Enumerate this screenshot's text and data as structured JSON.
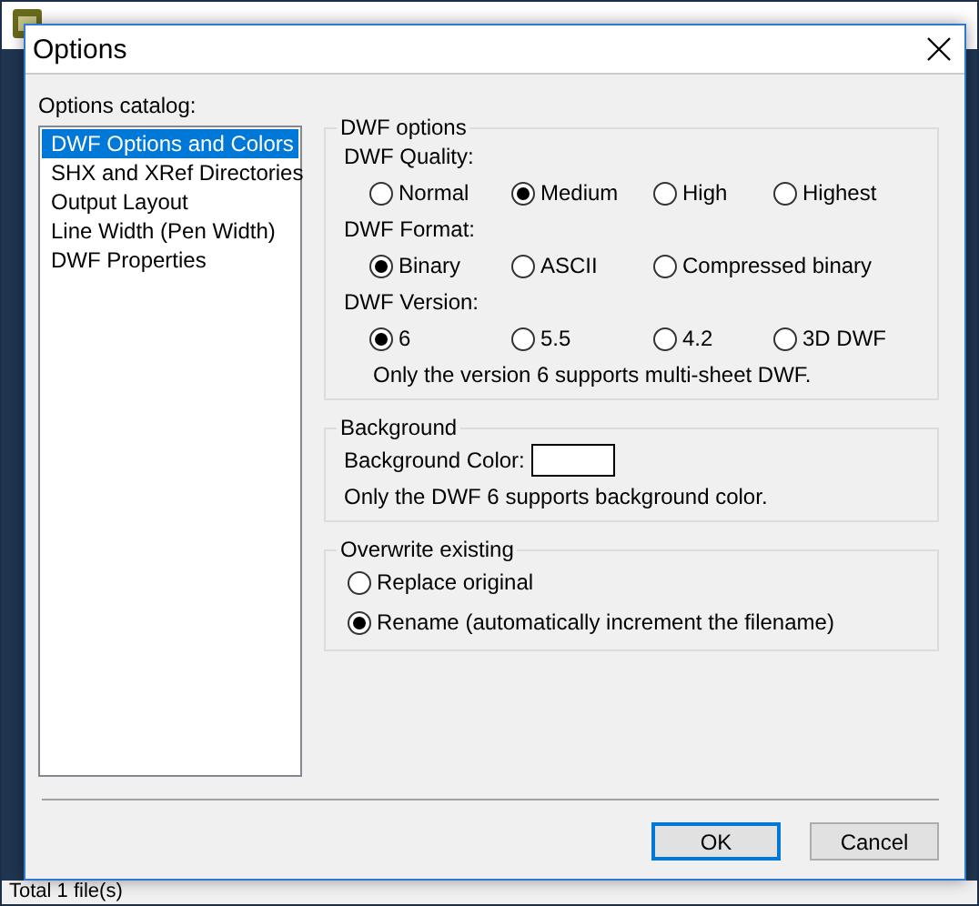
{
  "parent_window": {
    "status_bar": "Total 1 file(s)"
  },
  "dialog": {
    "title": "Options",
    "catalog": {
      "label": "Options catalog:",
      "items": [
        {
          "label": "DWF Options and Colors",
          "selected": true
        },
        {
          "label": "SHX and XRef Directories",
          "selected": false
        },
        {
          "label": "Output Layout",
          "selected": false
        },
        {
          "label": "Line Width (Pen Width)",
          "selected": false
        },
        {
          "label": "DWF Properties",
          "selected": false
        }
      ]
    },
    "dwf_options": {
      "title": "DWF options",
      "groups": [
        {
          "label": "DWF Quality:",
          "options": [
            {
              "label": "Normal",
              "selected": false
            },
            {
              "label": "Medium",
              "selected": true
            },
            {
              "label": "High",
              "selected": false
            },
            {
              "label": "Highest",
              "selected": false
            }
          ]
        },
        {
          "label": "DWF Format:",
          "options": [
            {
              "label": "Binary",
              "selected": true
            },
            {
              "label": "ASCII",
              "selected": false
            },
            {
              "label": "Compressed binary",
              "selected": false
            }
          ]
        },
        {
          "label": "DWF Version:",
          "options": [
            {
              "label": "6",
              "selected": true
            },
            {
              "label": "5.5",
              "selected": false
            },
            {
              "label": "4.2",
              "selected": false
            },
            {
              "label": "3D DWF",
              "selected": false
            }
          ]
        }
      ],
      "note": "Only the version 6 supports multi-sheet DWF."
    },
    "background": {
      "title": "Background",
      "color_label": "Background Color:",
      "note": "Only the DWF 6 supports background color."
    },
    "overwrite": {
      "title": "Overwrite existing",
      "options": [
        {
          "label": "Replace original",
          "selected": false
        },
        {
          "label": "Rename (automatically increment the filename)",
          "selected": true
        }
      ]
    },
    "buttons": [
      {
        "label": "OK",
        "default": true
      },
      {
        "label": "Cancel",
        "default": false
      }
    ]
  }
}
